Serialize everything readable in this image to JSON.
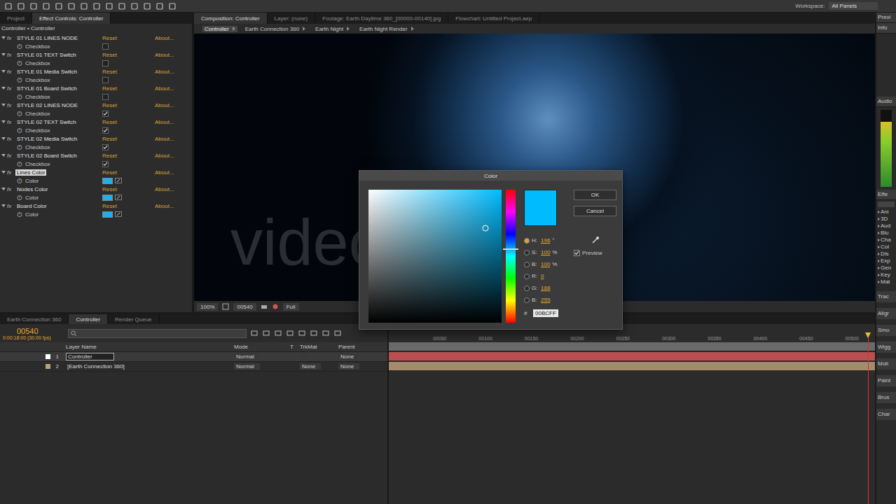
{
  "toolbar": {
    "workspace_label": "Workspace:",
    "workspace": "All Panels"
  },
  "effect_controls": {
    "tabs": [
      {
        "label": "Project",
        "selected": false
      },
      {
        "label": "Effect Controls: Controller",
        "selected": true
      }
    ],
    "header": "Controller • Controller",
    "fx_label": "fx",
    "reset_label": "Reset",
    "about_label": "About...",
    "effects": [
      {
        "name": "STYLE 01 LINES NODE",
        "kind": "checkbox",
        "param": "Checkbox",
        "checked": false,
        "selected": false
      },
      {
        "name": "STYLE 01 TEXT Switch",
        "kind": "checkbox",
        "param": "Checkbox",
        "checked": false,
        "selected": false
      },
      {
        "name": "STYLE 01 Media Switch",
        "kind": "checkbox",
        "param": "Checkbox",
        "checked": false,
        "selected": false
      },
      {
        "name": "STYLE 01 Board Switch",
        "kind": "checkbox",
        "param": "Checkbox",
        "checked": false,
        "selected": false
      },
      {
        "name": "STYLE 02 LINES NODE",
        "kind": "checkbox",
        "param": "Checkbox",
        "checked": true,
        "selected": false
      },
      {
        "name": "STYLE 02 TEXT Switch",
        "kind": "checkbox",
        "param": "Checkbox",
        "checked": true,
        "selected": false
      },
      {
        "name": "STYLE 02 Media Switch",
        "kind": "checkbox",
        "param": "Checkbox",
        "checked": true,
        "selected": false
      },
      {
        "name": "STYLE 02 Board Switch",
        "kind": "checkbox",
        "param": "Checkbox",
        "checked": true,
        "selected": false
      },
      {
        "name": "Lines Color",
        "kind": "color",
        "param": "Color",
        "color": "#1ab2ee",
        "selected": true
      },
      {
        "name": "Nodes Color",
        "kind": "color",
        "param": "Color",
        "color": "#1ab2ee",
        "selected": false
      },
      {
        "name": "Board Color",
        "kind": "color",
        "param": "Color",
        "color": "#1ab2ee",
        "selected": false
      }
    ]
  },
  "composition": {
    "tabs": [
      {
        "label": "Composition: Controller",
        "selected": true
      },
      {
        "label": "Layer: (none)",
        "selected": false
      },
      {
        "label": "Footage: Earth Daytime 360_[00000-00140].jpg",
        "selected": false
      },
      {
        "label": "Flowchart: Untitled Project.aep",
        "selected": false
      }
    ],
    "breadcrumbs": [
      {
        "label": "Controller",
        "selected": true
      },
      {
        "label": "Earth Connection 360",
        "selected": false
      },
      {
        "label": "Earth Night",
        "selected": false
      },
      {
        "label": "Earth Night Render",
        "selected": false
      }
    ],
    "watermark": "videohive",
    "viewer_bar": {
      "zoom": "100%",
      "time": "00540",
      "resolution": "Full"
    }
  },
  "color_dialog": {
    "title": "Color",
    "ok": "OK",
    "cancel": "Cancel",
    "preview": {
      "label": "Preview",
      "checked": true
    },
    "color": "#00bcff",
    "saturation_level": 0.88,
    "brightness_level": 0.71,
    "hue_level": 0.44,
    "fields": [
      {
        "label": "H:",
        "value": "196",
        "unit": "°",
        "selected": true
      },
      {
        "label": "S:",
        "value": "100",
        "unit": "%",
        "selected": false
      },
      {
        "label": "B:",
        "value": "100",
        "unit": "%",
        "selected": false
      },
      {
        "label": "R:",
        "value": "0",
        "unit": "",
        "selected": false
      },
      {
        "label": "G:",
        "value": "188",
        "unit": "",
        "selected": false
      },
      {
        "label": "B:",
        "value": "255",
        "unit": "",
        "selected": false
      }
    ],
    "hex_label": "#",
    "hex": "00BCFF"
  },
  "timeline": {
    "tabs": [
      {
        "label": "Earth Connection 360",
        "selected": false
      },
      {
        "label": "Controller",
        "selected": true
      },
      {
        "label": "Render Queue",
        "selected": false
      }
    ],
    "time": "00540",
    "fps": "0:00:18:00 (30.00 fps)",
    "columns": [
      "Layer Name",
      "Mode",
      "T",
      "TrkMat",
      "Parent"
    ],
    "layers": [
      {
        "index": "1",
        "name": "Controller",
        "mode": "Normal",
        "trkmat": "",
        "parent": "None",
        "selected": true,
        "color": "#b94f50",
        "label_color": "#ffffff"
      },
      {
        "index": "2",
        "name": "[Earth Connection 360]",
        "mode": "Normal",
        "trkmat": "None",
        "parent": "None",
        "selected": false,
        "color": "#a48b6b",
        "label_color": "#b9a27c"
      }
    ],
    "ticks": [
      "00050",
      "00100",
      "00150",
      "00200",
      "00250",
      "00300",
      "00350",
      "00400",
      "00450",
      "00500"
    ],
    "playhead_level": 0.985
  },
  "right_panel": {
    "preview": "Previ",
    "info": "Info",
    "audio": "Audio",
    "audio_level": 0.85,
    "effects": "Effe",
    "categories": [
      "Ani",
      "3D",
      "Aud",
      "Blu",
      "Cha",
      "Col",
      "Dis",
      "Exp",
      "Gen",
      "Key",
      "Mat"
    ],
    "panels": [
      "Trac",
      "Aligr",
      "Smo",
      "Wigg",
      "Moti",
      "Paint",
      "Brus",
      "Char"
    ]
  }
}
